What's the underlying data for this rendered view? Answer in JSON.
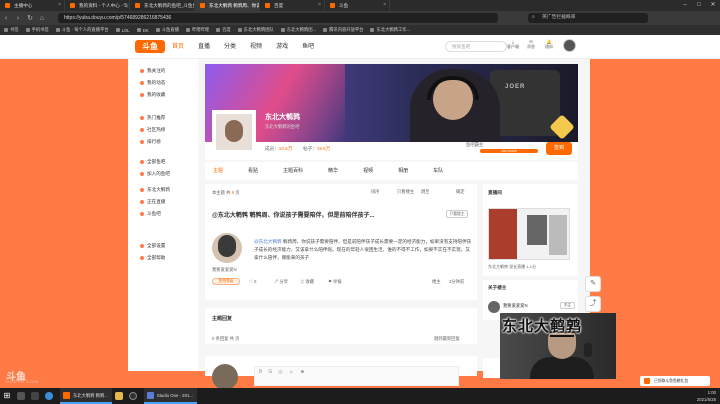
{
  "browser": {
    "tabs": [
      {
        "label": "主播中心",
        "active": false
      },
      {
        "label": "我的资料 - 个人中心 - 斗鱼",
        "active": false
      },
      {
        "label": "东北大鹌鹑的鱼吧_斗鱼鱼吧",
        "active": false
      },
      {
        "label": "东北大鹌鹑 鹌鹑周、你说孩子...",
        "active": true
      },
      {
        "label": "百度",
        "active": false
      },
      {
        "label": "斗鱼",
        "active": false
      }
    ],
    "url": "https://yuba.douyu.com/p/574689286216875436",
    "search_placeholder": "英广告拦截概率",
    "bookmarks": [
      "书签",
      "手机书签",
      "斗鱼 · 每个人的直播平台",
      "LOL",
      "DK",
      "斗鱼直播",
      "哔哩哔哩",
      "百度",
      "东北大鹌鹑团队",
      "东北大鹌鹑团...",
      "腾讯内容开放平台",
      "东北大鹌鹑工作..."
    ]
  },
  "header": {
    "logo": "斗鱼",
    "nav": [
      "首页",
      "直播",
      "分类",
      "视频",
      "游戏",
      "鱼吧"
    ],
    "active_nav": "首页",
    "search_placeholder": "搜索鱼吧",
    "icons": [
      {
        "name": "download-icon",
        "label": "客户端"
      },
      {
        "name": "message-icon",
        "label": "消息"
      },
      {
        "name": "bell-icon",
        "label": "通知"
      }
    ]
  },
  "sidebar": {
    "groups": [
      [
        "我关注的",
        "我的动态",
        "我的收藏"
      ],
      [
        "热门推荐",
        "社区热榜",
        "排行榜"
      ],
      [
        "全部鱼吧",
        "加入的鱼吧"
      ],
      [
        "东北大鹌鹑",
        "正在直播",
        "斗鱼吧"
      ],
      [
        "全部设置",
        "全部帮助"
      ]
    ]
  },
  "group": {
    "name": "东北大鹌鹑",
    "subtitle": "东北大鹌鹑的鱼吧",
    "members_label": "成员：",
    "members_value": "10.6万",
    "posts_label": "帖子：",
    "posts_value": "19.6万",
    "level_label": "鱼吧霸主",
    "level_progress": "2487/10000",
    "sign_button": "签到",
    "banner_text": "JOER",
    "tabs": [
      "主题",
      "看贴",
      "主题百科",
      "精华",
      "视频",
      "相册",
      "车队"
    ],
    "active_tab": "主题"
  },
  "post": {
    "toolbar_prefix": "本主题 共",
    "toolbar_count": "8",
    "toolbar_suffix": "页",
    "sort_label_1": "排序",
    "sort_label_2": "只看楼主",
    "sort_label_3": "跳至",
    "sort_label_4": "确定",
    "title": "@东北大鹌鹑 鹌鹑周、你说孩子需要陪伴，但是前陪伴孩子...",
    "tag": "只看楼主",
    "mention": "@东北大鹌鹑",
    "body": " 鹌鹑周、你说孩子需要陪伴，但是前陪伴孩子成长需要一定的经济能力，如果没有支持陪伴孩子成长的经济能力，又该拿什么陪伴呢。现在的年轻人很困生活，谁的不得不工作，如果不实在不实现，又拿什么陪伴，哪能来的孩子",
    "author": "我要爱爱爱N",
    "level": "鱼吧等级",
    "likes": "0",
    "share": "分享",
    "collect": "收藏",
    "report": "举报",
    "floor": "楼主",
    "time": "3分钟前",
    "reply_title": "主题回复",
    "reply_count_prefix": "0 条回复 共",
    "reply_count_suffix": "页",
    "reply_link": "跳到最新回复",
    "editor_tools": [
      "B",
      "G",
      "◎",
      "☺",
      "☻"
    ]
  },
  "right": {
    "live_title": "直播间",
    "live_caption": "东北大鹌鹑 党长直播 1-1分",
    "owner_title": "关于楼主",
    "owner_name": "我要爱爱爱N",
    "owner_button": "关注"
  },
  "overlay": {
    "watermark": "东北大鹌鹑",
    "douyu_logo": "斗鱼",
    "douyu_sub": "DOUYU.COM",
    "toast": "已领取斗鱼鱼粮礼包"
  },
  "taskbar": {
    "apps": [
      "东北大鹌鹑 鹌鹑...",
      "Studio One - 201..."
    ],
    "time": "1:00",
    "date": "2021/5/25"
  }
}
